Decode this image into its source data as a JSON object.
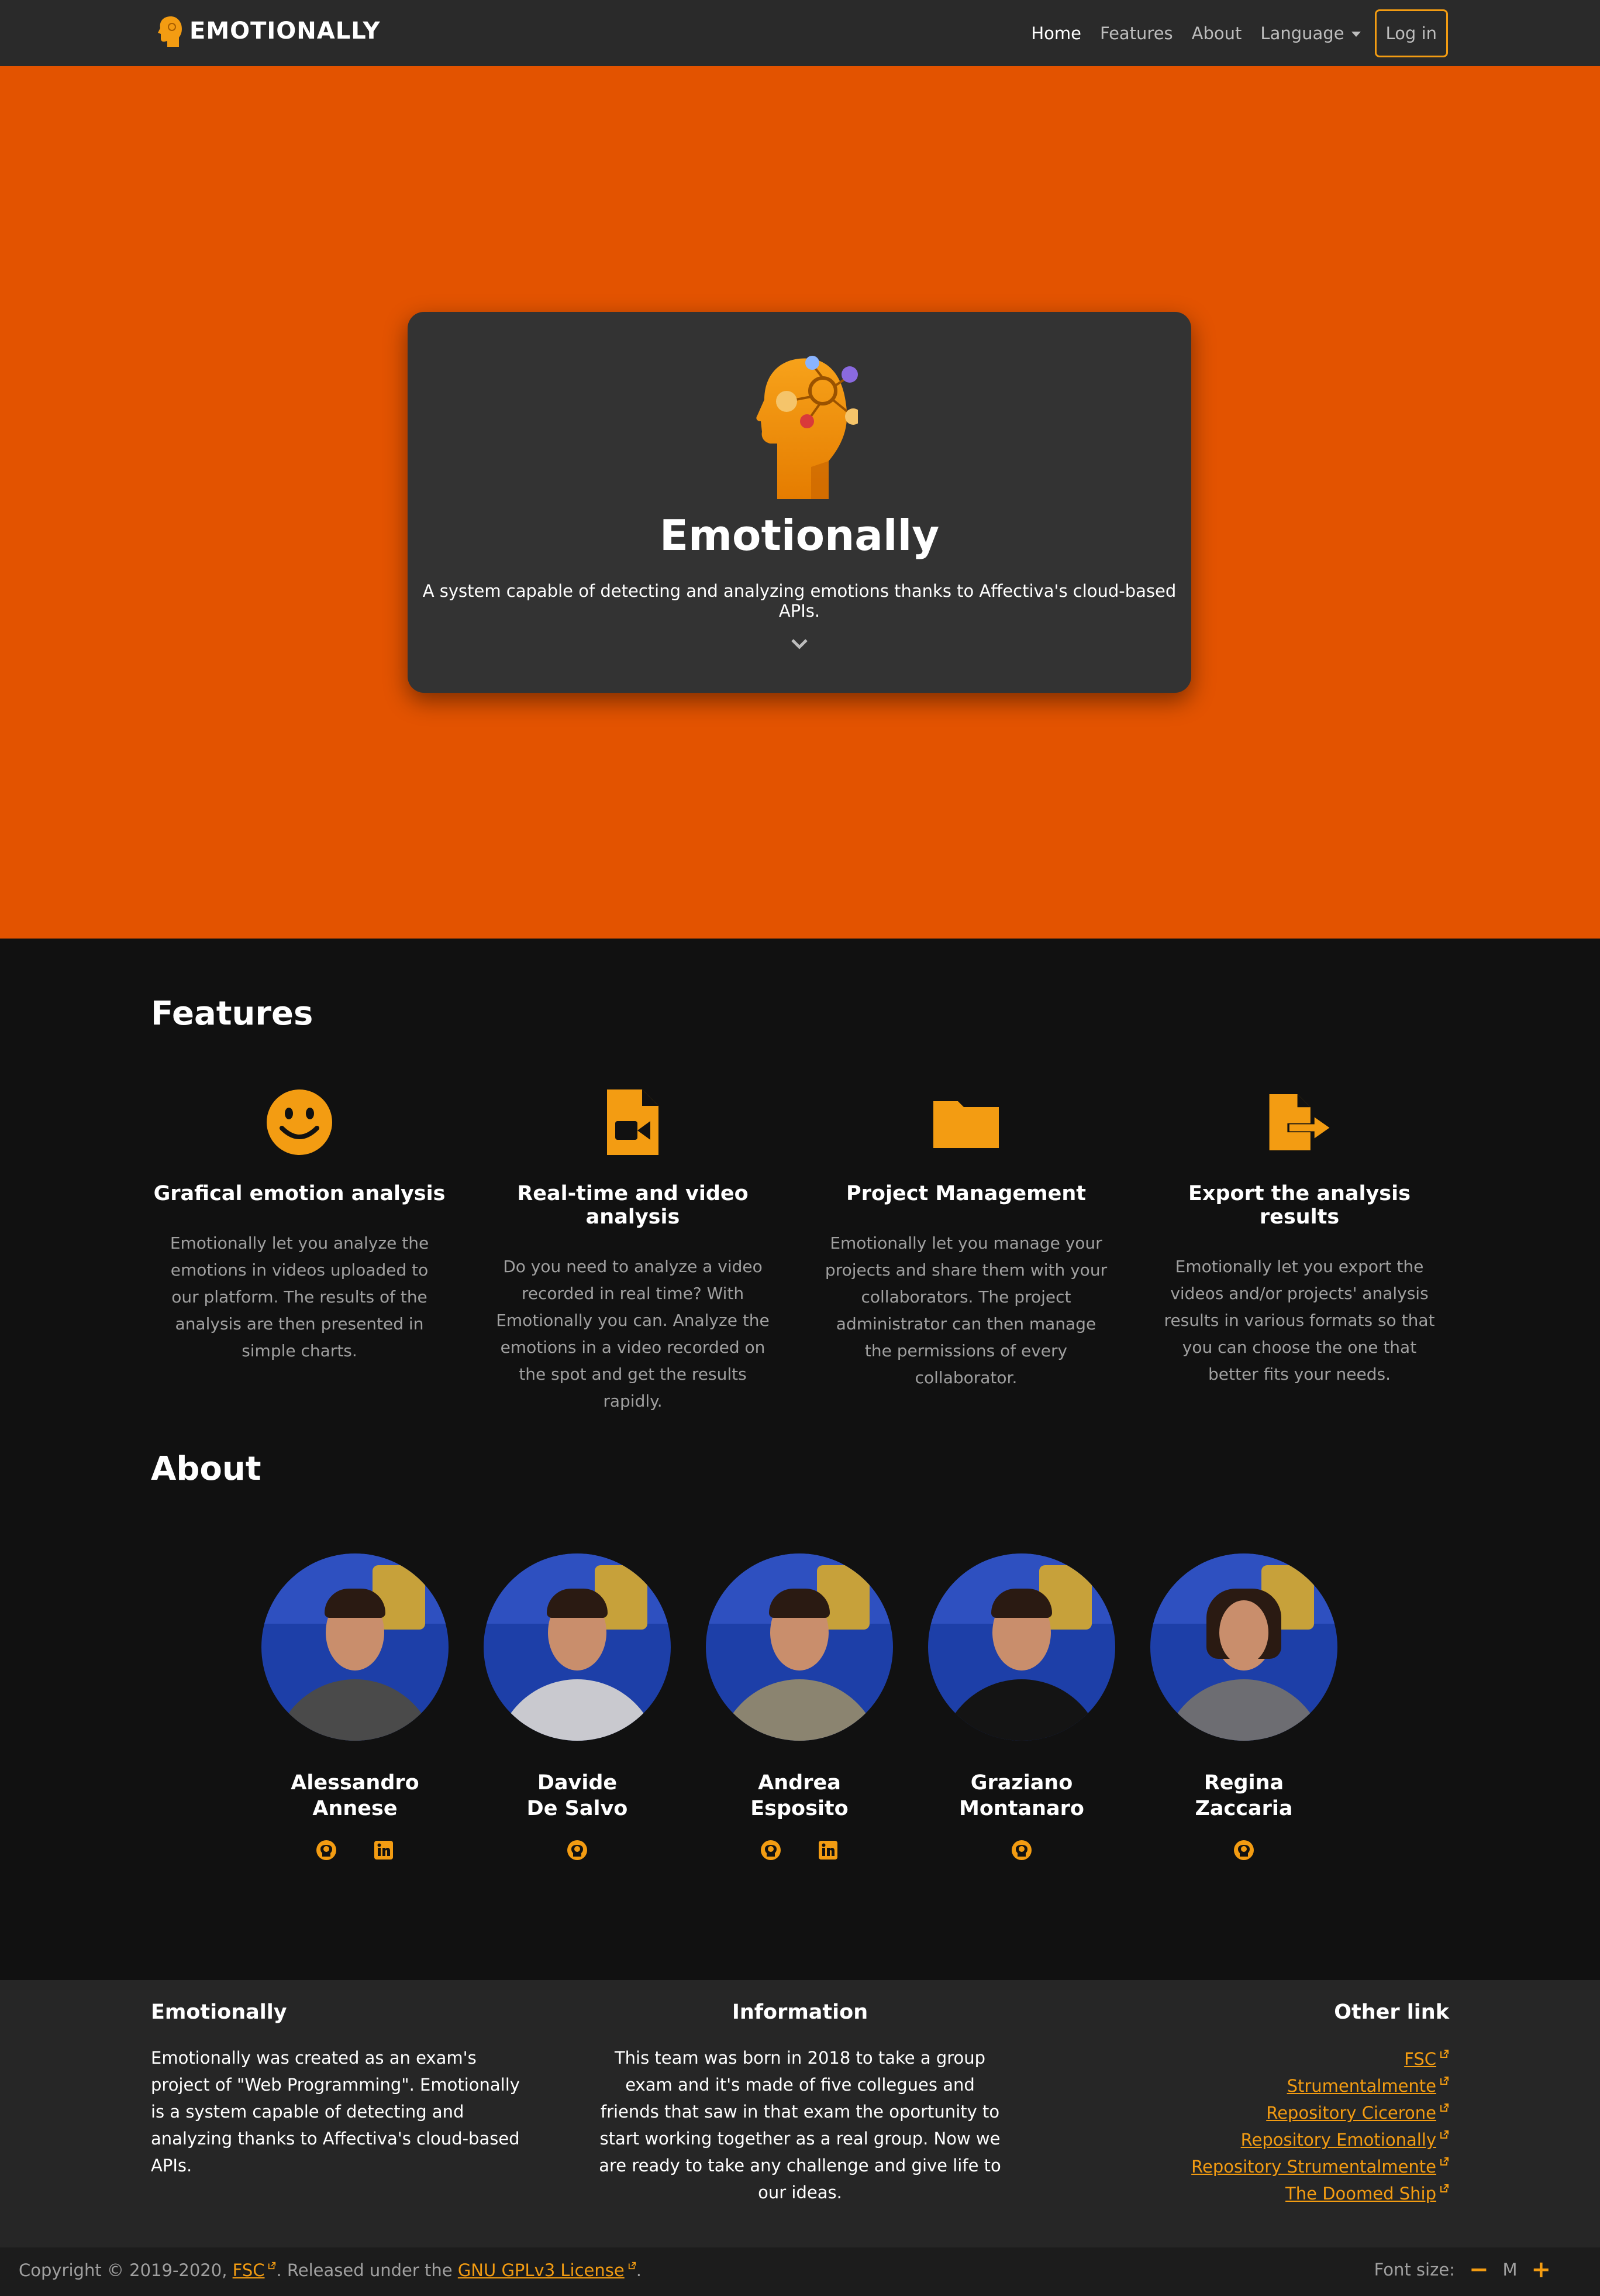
{
  "colors": {
    "accent": "#f39c12",
    "hero_bg": "#e35300",
    "page_bg": "#111111",
    "navbar_bg": "#2a2a2a",
    "card_bg": "#333333"
  },
  "navbar": {
    "brand": "EMOTIONALLY",
    "links": {
      "home": "Home",
      "features": "Features",
      "about": "About",
      "language": "Language"
    },
    "login": "Log in"
  },
  "hero": {
    "title": "Emotionally",
    "subtitle": "A system capable of detecting and analyzing emotions thanks to Affectiva's cloud-based APIs."
  },
  "features": {
    "title": "Features",
    "items": [
      {
        "icon": "smile-icon",
        "title": "Grafical emotion analysis",
        "desc": "Emotionally let you analyze the emotions in videos uploaded to our platform. The results of the analysis are then presented in simple charts."
      },
      {
        "icon": "video-file-icon",
        "title": "Real-time and video analysis",
        "desc": "Do you need to analyze a video recorded in real time? With Emotionally you can. Analyze the emotions in a video recorded on the spot and get the results rapidly."
      },
      {
        "icon": "folder-icon",
        "title": "Project Management",
        "desc": "Emotionally let you manage your projects and share them with your collaborators. The project administrator can then manage the permissions of every collaborator."
      },
      {
        "icon": "file-export-icon",
        "title": "Export the analysis results",
        "desc": "Emotionally let you export the videos and/or projects' analysis results in various formats so that you can choose the one that better fits your needs."
      }
    ]
  },
  "about": {
    "title": "About",
    "members": [
      {
        "first": "Alessandro",
        "last": "Annese",
        "social": [
          "github-icon",
          "linkedin-icon"
        ]
      },
      {
        "first": "Davide",
        "last": "De Salvo",
        "social": [
          "github-icon"
        ]
      },
      {
        "first": "Andrea",
        "last": "Esposito",
        "social": [
          "github-icon",
          "linkedin-icon"
        ]
      },
      {
        "first": "Graziano",
        "last": "Montanaro",
        "social": [
          "github-icon"
        ]
      },
      {
        "first": "Regina",
        "last": "Zaccaria",
        "social": [
          "github-icon"
        ]
      }
    ]
  },
  "footer": {
    "col1_title": "Emotionally",
    "col1_text": "Emotionally was created as an exam's project of \"Web Programming\". Emotionally is a system capable of detecting and analyzing thanks to Affectiva's cloud-based APIs.",
    "col2_title": "Information",
    "col2_text": "This team was born in 2018 to take a group exam and it's made of five collegues and friends that saw in that exam the oportunity to start working together as a real group. Now we are ready to take any challenge and give life to our ideas.",
    "col3_title": "Other link",
    "links": [
      "FSC",
      "Strumentalmente",
      "Repository Cicerone",
      "Repository Emotionally",
      "Repository Strumentalmente",
      "The Doomed Ship"
    ]
  },
  "bottom": {
    "copyright_prefix": "Copyright © 2019-2020,",
    "fsc_link": "FSC",
    "released": ". Released under the",
    "license_link": "GNU GPLv3 License",
    "end": ".",
    "font_size_label": "Font size:",
    "font_size_minus": "−",
    "font_size_value": "M",
    "font_size_plus": "+"
  }
}
